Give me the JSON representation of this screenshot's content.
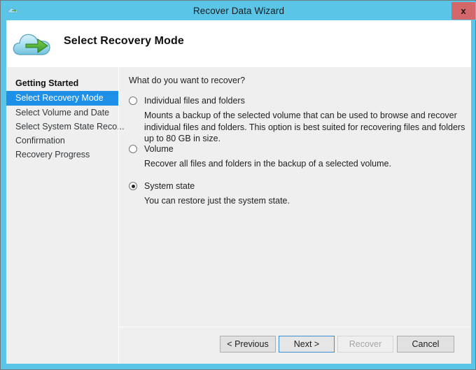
{
  "window": {
    "title": "Recover Data Wizard",
    "close_label": "x",
    "icon": "cloud-arrow-icon",
    "titlebar_color": "#5bc5e8",
    "close_color": "#d2686a"
  },
  "header": {
    "title": "Select Recovery Mode",
    "icon": "cloud-recovery-icon"
  },
  "sidebar": {
    "items": [
      {
        "label": "Getting Started",
        "state": "completed"
      },
      {
        "label": "Select Recovery Mode",
        "state": "active"
      },
      {
        "label": "Select Volume and Date",
        "state": "pending"
      },
      {
        "label": "Select System State Reco...",
        "state": "pending"
      },
      {
        "label": "Confirmation",
        "state": "pending"
      },
      {
        "label": "Recovery Progress",
        "state": "pending"
      }
    ],
    "active_color": "#1e90e8"
  },
  "main": {
    "question": "What do you want to recover?",
    "options": [
      {
        "label": "Individual files and folders",
        "description": "Mounts a backup of the selected volume that can be used to browse and recover individual files and folders. This option is best suited for recovering files and folders up to 80 GB in size.",
        "selected": false
      },
      {
        "label": "Volume",
        "description": "Recover all files and folders in the backup of a selected volume.",
        "selected": false
      },
      {
        "label": "System state",
        "description": "You can restore just the system state.",
        "selected": true
      }
    ]
  },
  "footer": {
    "buttons": [
      {
        "label": "< Previous",
        "state": "enabled"
      },
      {
        "label": "Next >",
        "state": "focused"
      },
      {
        "label": "Recover",
        "state": "disabled"
      },
      {
        "label": "Cancel",
        "state": "enabled"
      }
    ]
  }
}
